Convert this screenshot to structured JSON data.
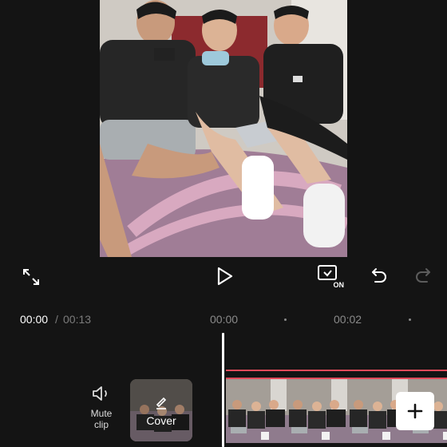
{
  "controls": {
    "fullscreen_icon": "fullscreen-icon",
    "play_icon": "play-icon",
    "keyframe_badge": "ON",
    "undo_icon": "undo-icon",
    "redo_icon": "redo-icon"
  },
  "timeline": {
    "current_time": "00:00",
    "separator": "/",
    "total_time": "00:13",
    "ruler_ticks": [
      "00:00",
      "00:02"
    ]
  },
  "mute": {
    "label": "Mute clip"
  },
  "cover": {
    "label": "Cover"
  },
  "colors": {
    "accent_red": "#e04a5a",
    "background": "#141414"
  }
}
